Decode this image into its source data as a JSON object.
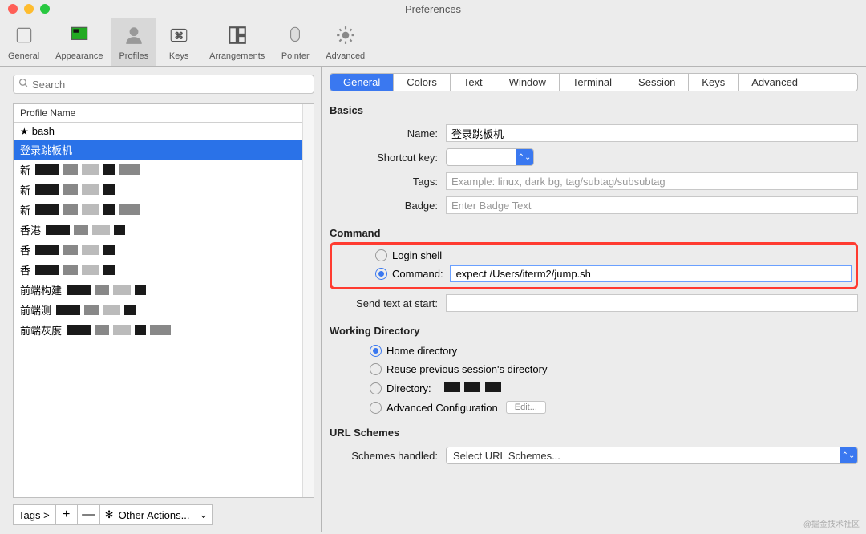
{
  "window": {
    "title": "Preferences"
  },
  "toolbar": [
    {
      "id": "general",
      "label": "General",
      "selected": false
    },
    {
      "id": "appearance",
      "label": "Appearance",
      "selected": false
    },
    {
      "id": "profiles",
      "label": "Profiles",
      "selected": true
    },
    {
      "id": "keys",
      "label": "Keys",
      "selected": false
    },
    {
      "id": "arrangements",
      "label": "Arrangements",
      "selected": false
    },
    {
      "id": "pointer",
      "label": "Pointer",
      "selected": false
    },
    {
      "id": "advanced",
      "label": "Advanced",
      "selected": false
    }
  ],
  "search": {
    "placeholder": "Search"
  },
  "profiles": {
    "header": "Profile Name",
    "items": [
      {
        "label": "bash",
        "star": true,
        "selected": false
      },
      {
        "label": "登录跳板机",
        "selected": true
      },
      {
        "label": "新",
        "redacted": true
      },
      {
        "label": "新",
        "redacted": true
      },
      {
        "label": "新",
        "redacted": true
      },
      {
        "label": "香港",
        "redacted": true
      },
      {
        "label": "香",
        "redacted": true
      },
      {
        "label": "香",
        "redacted": true
      },
      {
        "label": "前端构建",
        "redacted": true
      },
      {
        "label": "前端测",
        "redacted": true
      },
      {
        "label": "前端灰度",
        "redacted": true
      }
    ]
  },
  "bottom": {
    "tags": "Tags >",
    "plus": "+",
    "minus": "—",
    "other": "Other Actions...",
    "chev": "⌄"
  },
  "tabs": [
    "General",
    "Colors",
    "Text",
    "Window",
    "Terminal",
    "Session",
    "Keys",
    "Advanced"
  ],
  "activeTab": "General",
  "basics": {
    "heading": "Basics",
    "nameLabel": "Name:",
    "nameValue": "登录跳板机",
    "shortcutLabel": "Shortcut key:",
    "shortcutValue": "",
    "tagsLabel": "Tags:",
    "tagsPlaceholder": "Example: linux, dark bg, tag/subtag/subsubtag",
    "badgeLabel": "Badge:",
    "badgePlaceholder": "Enter Badge Text"
  },
  "command": {
    "heading": "Command",
    "loginShell": "Login shell",
    "commandLabel": "Command:",
    "commandValue": "expect /Users/iterm2/jump.sh",
    "sendTextLabel": "Send text at start:",
    "sendTextValue": ""
  },
  "workingDir": {
    "heading": "Working Directory",
    "home": "Home directory",
    "reuse": "Reuse previous session's directory",
    "dir": "Directory:",
    "advanced": "Advanced Configuration",
    "edit": "Edit..."
  },
  "urlSchemes": {
    "heading": "URL Schemes",
    "label": "Schemes handled:",
    "selectLabel": "Select URL Schemes..."
  },
  "watermark": "@掘金技术社区"
}
